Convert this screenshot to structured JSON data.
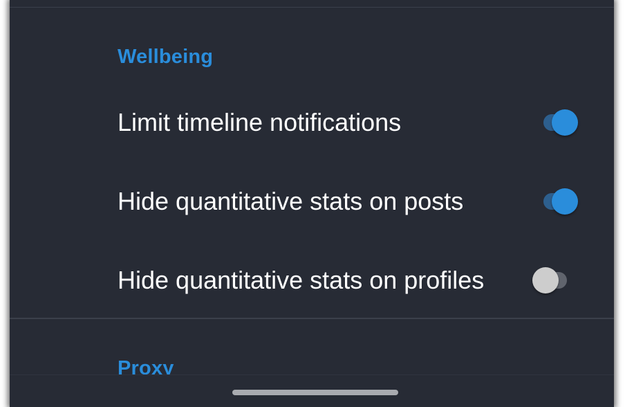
{
  "sections": {
    "wellbeing": {
      "header": "Wellbeing",
      "settings": [
        {
          "label": "Limit timeline notifications",
          "enabled": true
        },
        {
          "label": "Hide quantitative stats on posts",
          "enabled": true
        },
        {
          "label": "Hide quantitative stats on profiles",
          "enabled": false
        }
      ]
    },
    "proxy": {
      "header": "Proxy"
    }
  },
  "colors": {
    "background": "#272b35",
    "accent": "#2a8ddb",
    "text": "#ffffff",
    "toggle_off_thumb": "#cdcdcd"
  },
  "icons": {
    "home_indicator": "home-gesture-bar"
  }
}
